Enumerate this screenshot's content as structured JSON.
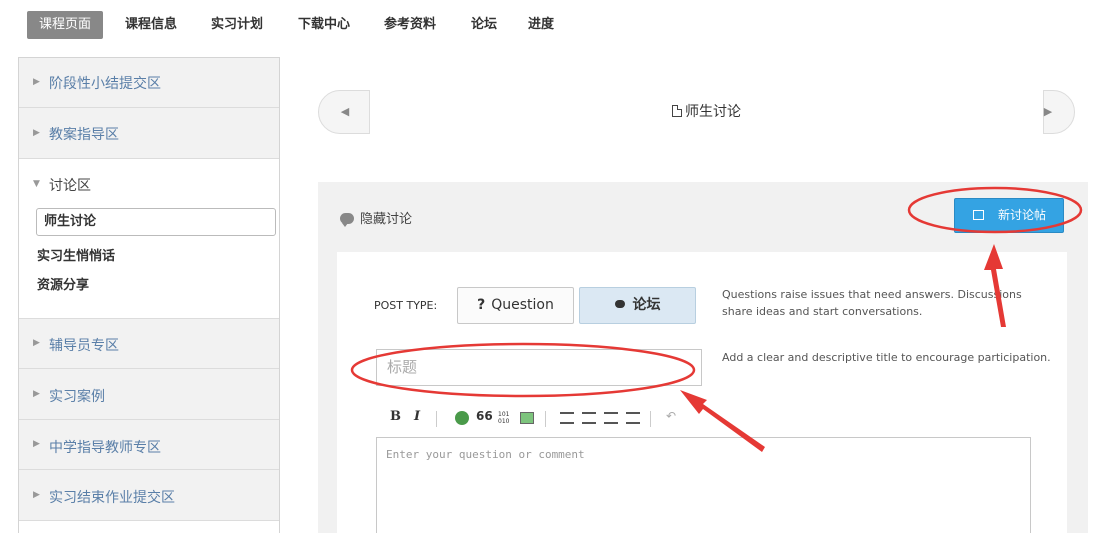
{
  "nav": {
    "tabs": [
      "课程页面",
      "课程信息",
      "实习计划",
      "下载中心",
      "参考资料",
      "论坛",
      "进度"
    ]
  },
  "sidebar": {
    "sections": [
      "阶段性小结提交区",
      "教案指导区",
      "讨论区",
      "辅导员专区",
      "实习案例",
      "中学指导教师专区",
      "实习结束作业提交区"
    ],
    "subitems": [
      "师生讨论",
      "实习生悄悄话",
      "资源分享"
    ]
  },
  "main": {
    "sequence_title": "师生讨论",
    "hide_discussion": "隐藏讨论",
    "new_post": "新讨论帖",
    "post_type_label": "POST TYPE:",
    "question_label": "Question",
    "discussion_label": "论坛",
    "post_type_help": "Questions raise issues that need answers. Discussions share ideas and start conversations.",
    "title_placeholder": "标题",
    "title_help": "Add a clear and descriptive title to encourage participation.",
    "editor_placeholder": "Enter your question or comment",
    "toolbar": {
      "bold": "B",
      "italic": "I",
      "quote": "66",
      "code": "101\n010"
    }
  },
  "colors": {
    "accent": "#34a3e3",
    "annotation": "#e53935",
    "active_tab": "#888888"
  }
}
